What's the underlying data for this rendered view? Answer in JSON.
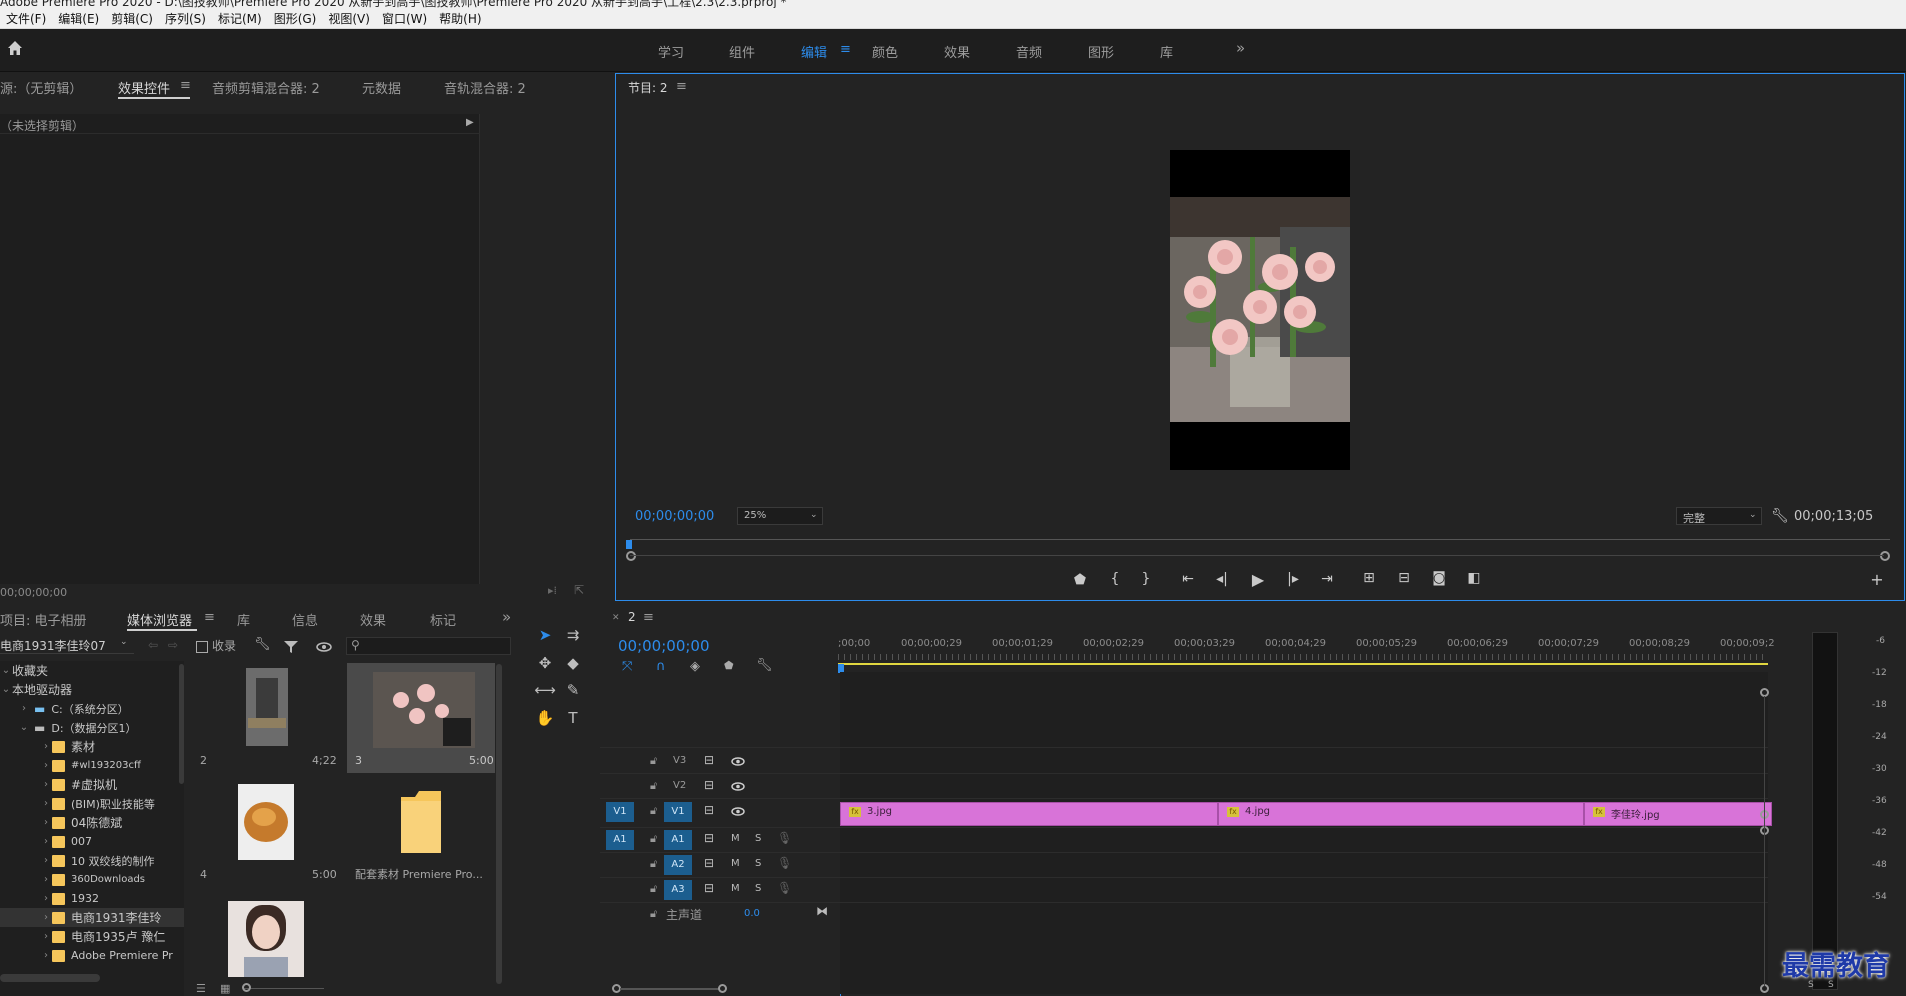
{
  "window": {
    "title": "Adobe Premiere Pro 2020 - D:\\图技教师\\Premiere Pro 2020 从新手到高手\\图技教师\\Premiere Pro 2020 从新手到高手\\工程\\2.3\\2.3.prproj *"
  },
  "menu": [
    "文件(F)",
    "编辑(E)",
    "剪辑(C)",
    "序列(S)",
    "标记(M)",
    "图形(G)",
    "视图(V)",
    "窗口(W)",
    "帮助(H)"
  ],
  "workspaces": {
    "items": [
      "学习",
      "组件",
      "编辑",
      "颜色",
      "效果",
      "音频",
      "图形",
      "库"
    ],
    "active": "编辑",
    "more": "»"
  },
  "source_panel": {
    "tabs": [
      "源:（无剪辑）",
      "效果控件",
      "音频剪辑混合器: 2",
      "元数据",
      "音轨混合器: 2"
    ],
    "active_tab": "效果控件",
    "no_clip": "（未选择剪辑）",
    "timecode": "00;00;00;00"
  },
  "program_monitor": {
    "title": "节目: 2",
    "timecode_in": "00;00;00;00",
    "zoom": "25%",
    "quality": "完整",
    "timecode_out": "00;00;13;05"
  },
  "project_panel": {
    "tabs": [
      "项目: 电子相册",
      "媒体浏览器",
      "库",
      "信息",
      "效果",
      "标记"
    ],
    "active_tab": "媒体浏览器",
    "path": "电商1931李佳玲07",
    "ingest": "收录",
    "search_placeholder": "",
    "tree": [
      {
        "label": "收藏夹",
        "level": 0,
        "type": "group"
      },
      {
        "label": "本地驱动器",
        "level": 0,
        "type": "group"
      },
      {
        "label": "C:（系统分区）",
        "level": 1,
        "type": "drive"
      },
      {
        "label": "D:（数据分区1）",
        "level": 1,
        "type": "drive"
      },
      {
        "label": "素材",
        "level": 2,
        "type": "folder"
      },
      {
        "label": "#wl193203cff",
        "level": 2,
        "type": "folder"
      },
      {
        "label": "#虚拟机",
        "level": 2,
        "type": "folder"
      },
      {
        "label": "(BIM)职业技能等",
        "level": 2,
        "type": "folder"
      },
      {
        "label": "04陈德斌",
        "level": 2,
        "type": "folder"
      },
      {
        "label": "007",
        "level": 2,
        "type": "folder"
      },
      {
        "label": "10 双绞线的制作",
        "level": 2,
        "type": "folder"
      },
      {
        "label": "360Downloads",
        "level": 2,
        "type": "folder"
      },
      {
        "label": "1932",
        "level": 2,
        "type": "folder"
      },
      {
        "label": "电商1931李佳玲",
        "level": 2,
        "type": "folder",
        "selected": true
      },
      {
        "label": "电商1935卢 豫仁",
        "level": 2,
        "type": "folder"
      },
      {
        "label": "Adobe Premiere Pr",
        "level": 2,
        "type": "folder"
      }
    ],
    "thumbs": [
      {
        "name": "2",
        "duration": "4;22"
      },
      {
        "name": "3",
        "duration": "5:00",
        "selected": true
      },
      {
        "name": "4",
        "duration": "5:00"
      },
      {
        "name": "配套素材 Premiere Pro...",
        "duration": ""
      },
      {
        "name": "",
        "duration": ""
      }
    ]
  },
  "timeline": {
    "tab": "2",
    "timecode": "00;00;00;00",
    "ruler": [
      ";00;00",
      "00;00;00;29",
      "00;00;01;29",
      "00;00;02;29",
      "00;00;03;29",
      "00;00;04;29",
      "00;00;05;29",
      "00;00;06;29",
      "00;00;07;29",
      "00;00;08;29",
      "00;00;09;2"
    ],
    "video_tracks": [
      "V3",
      "V2",
      "V1"
    ],
    "audio_tracks": [
      "A1",
      "A2",
      "A3"
    ],
    "mute": "M",
    "solo": "S",
    "master": {
      "label": "主声道",
      "value": "0.0"
    },
    "clips": [
      {
        "name": "3.jpg"
      },
      {
        "name": "4.jpg"
      },
      {
        "name": "李佳玲.jpg"
      }
    ]
  },
  "meter": {
    "labels": [
      "-6",
      "-12",
      "-18",
      "-24",
      "-30",
      "-36",
      "-42",
      "-48",
      "-54"
    ],
    "bottom": [
      "S",
      "S"
    ]
  },
  "watermark": "最需教育",
  "colors": {
    "accent": "#2d8ceb",
    "clip": "#d873d8",
    "track_btn": "#1c5e8f",
    "folder": "#f6c65b"
  }
}
